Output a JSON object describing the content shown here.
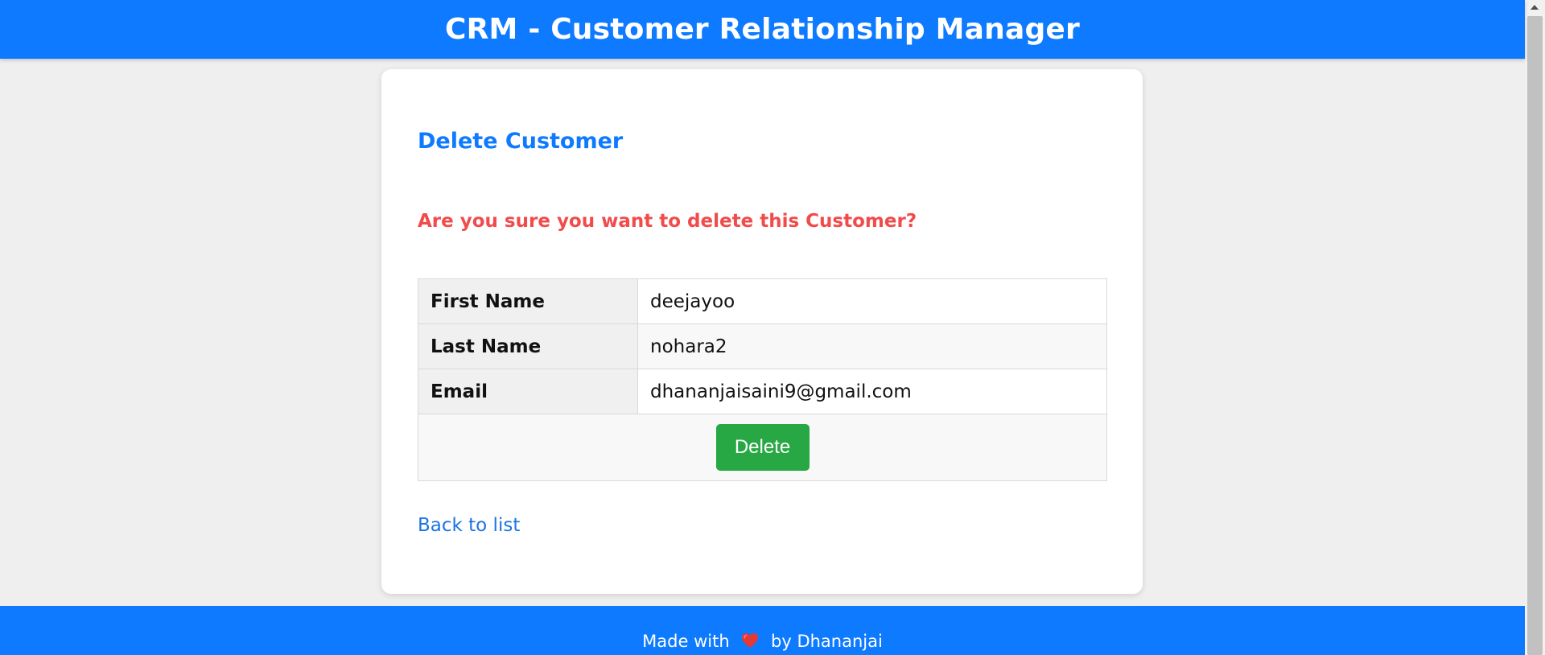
{
  "header": {
    "title": "CRM - Customer Relationship Manager"
  },
  "card": {
    "title": "Delete Customer",
    "warning": "Are you sure you want to delete this Customer?",
    "fields": [
      {
        "label": "First Name",
        "value": "deejayoo"
      },
      {
        "label": "Last Name",
        "value": "nohara2"
      },
      {
        "label": "Email",
        "value": "dhananjaisaini9@gmail.com"
      }
    ],
    "delete_label": "Delete",
    "back_label": "Back to list"
  },
  "footer": {
    "made_with": "Made with",
    "heart_icon": "heart-icon",
    "by_text": "by Dhananjai"
  },
  "colors": {
    "primary": "#0d7aff",
    "warning": "#f24b4b",
    "delete_button": "#28a745",
    "link": "#1b74e4"
  }
}
